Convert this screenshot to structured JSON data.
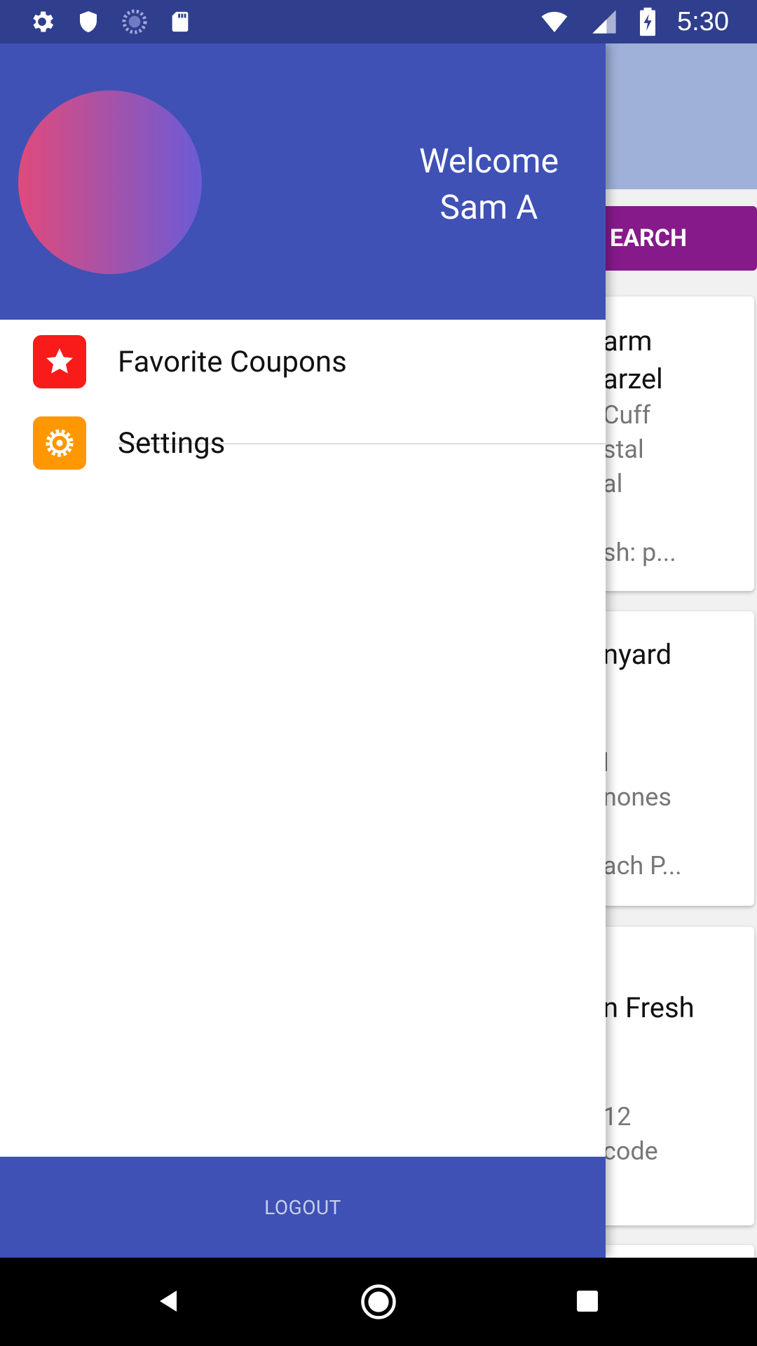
{
  "status_bar": {
    "time": "5:30",
    "left_icons": [
      "gear-icon",
      "shield-icon",
      "loading-icon",
      "sd-card-icon"
    ],
    "right_icons": [
      "wifi-icon",
      "signal-icon",
      "battery-charging-icon"
    ]
  },
  "background": {
    "search_button_label": "EARCH",
    "cards": [
      {
        "lines": [
          "arm",
          "arzel",
          "Cuff",
          "stal",
          "al",
          "sh: p..."
        ]
      },
      {
        "lines": [
          "nyard",
          "l",
          "nones",
          "ach P..."
        ]
      },
      {
        "lines": [
          "n Fresh",
          "12",
          "code"
        ]
      }
    ]
  },
  "drawer": {
    "welcome_line1": "Welcome",
    "welcome_line2": "Sam A",
    "menu": [
      {
        "label": "Favorite Coupons",
        "icon": "star-icon",
        "color": "#F91A1A"
      },
      {
        "label": "Settings",
        "icon": "gear-icon",
        "color": "#FF9800"
      }
    ],
    "logout_label": "LOGOUT"
  },
  "nav_bar": {
    "icons": [
      "back-icon",
      "home-icon",
      "recents-icon"
    ]
  },
  "colors": {
    "primary": "#3F51B5",
    "status_bar": "#2F3F8E",
    "accent_purple": "#861A8B"
  }
}
